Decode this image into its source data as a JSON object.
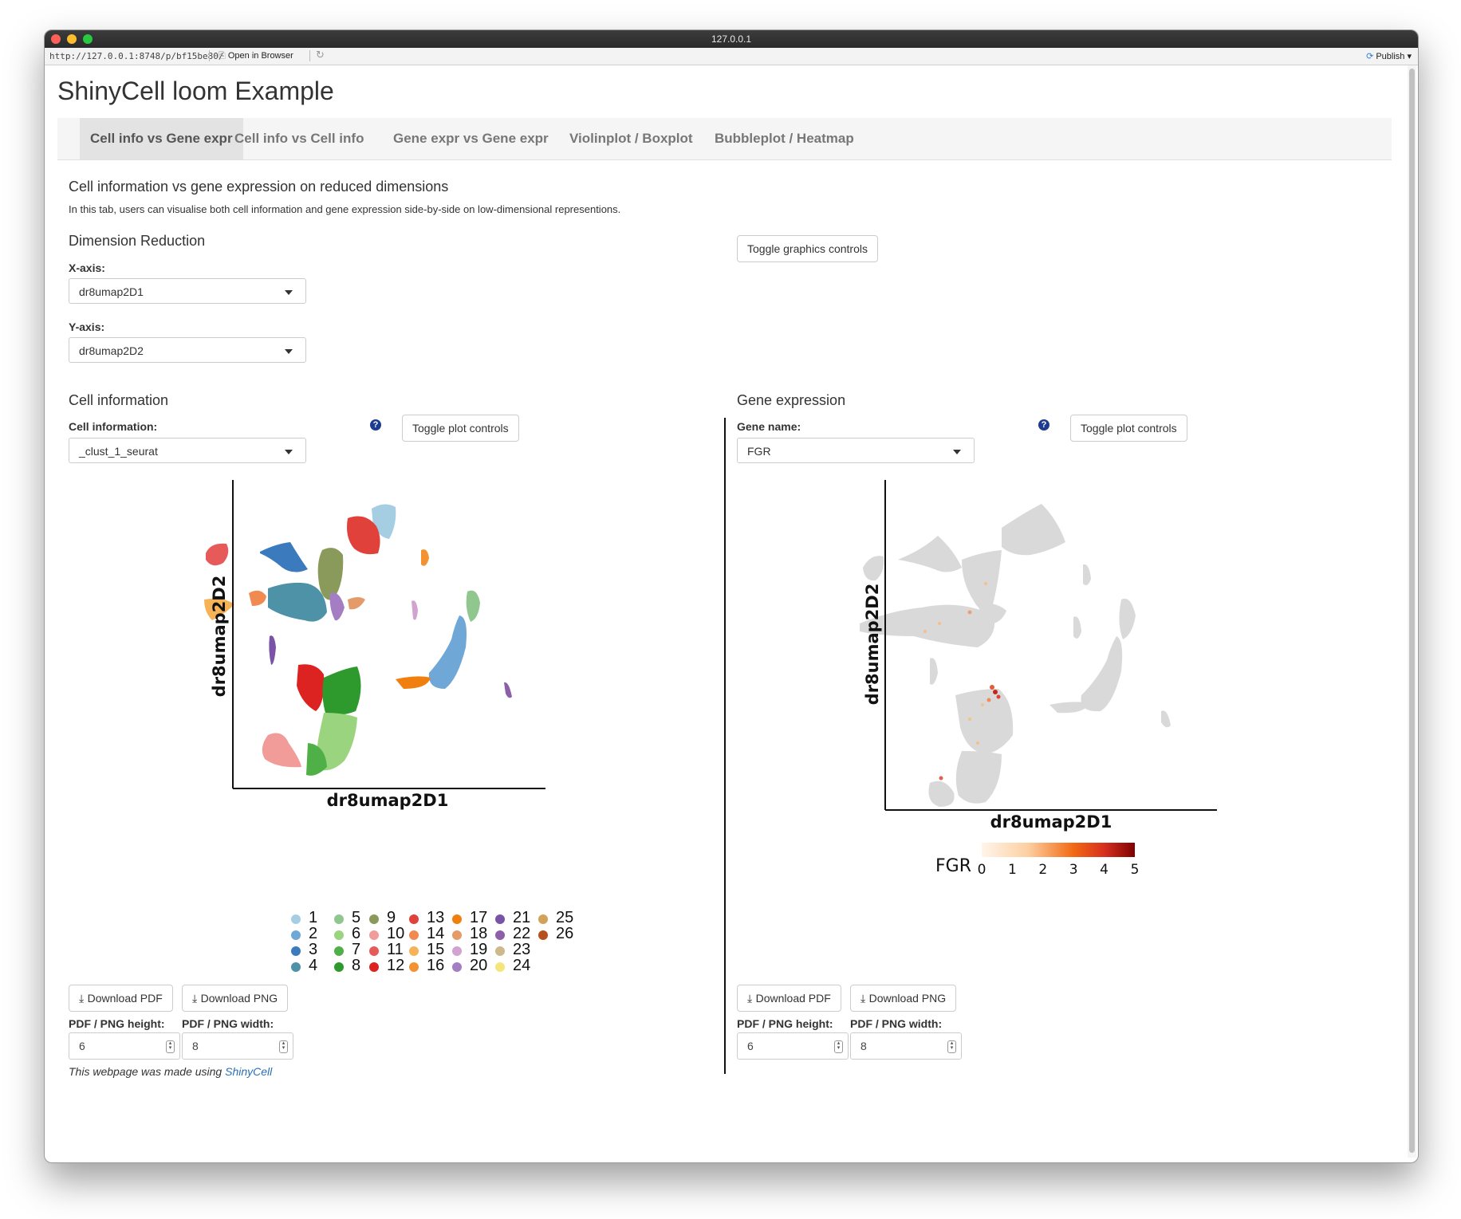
{
  "window": {
    "title": "127.0.0.1"
  },
  "addressbar": {
    "url": "http://127.0.0.1:8748/p/bf15be80/",
    "open_in_browser": "Open in Browser",
    "publish": "Publish"
  },
  "app": {
    "title": "ShinyCell loom Example"
  },
  "tabs": [
    {
      "label": "Cell info vs Gene expr",
      "active": true
    },
    {
      "label": "Cell info vs Cell info",
      "active": false
    },
    {
      "label": "Gene expr vs Gene expr",
      "active": false
    },
    {
      "label": "Violinplot / Boxplot",
      "active": false
    },
    {
      "label": "Bubbleplot / Heatmap",
      "active": false
    }
  ],
  "intro": {
    "title": "Cell information vs gene expression on reduced dimensions",
    "description": "In this tab, users can visualise both cell information and gene expression side-by-side on low-dimensional representions."
  },
  "dimred": {
    "title": "Dimension Reduction",
    "x_label": "X-axis:",
    "x_value": "dr8umap2D1",
    "y_label": "Y-axis:",
    "y_value": "dr8umap2D2",
    "toggle_graphics": "Toggle graphics controls"
  },
  "cellinfo": {
    "title": "Cell information",
    "field_label": "Cell information:",
    "field_value": "_clust_1_seurat",
    "toggle": "Toggle plot controls",
    "help_icon": "?",
    "xlabel": "dr8umap2D1",
    "ylabel": "dr8umap2D2",
    "download_pdf": "Download PDF",
    "download_png": "Download PNG",
    "height_label": "PDF / PNG height:",
    "width_label": "PDF / PNG width:",
    "height_value": "6",
    "width_value": "8"
  },
  "geneexpr": {
    "title": "Gene expression",
    "field_label": "Gene name:",
    "field_value": "FGR",
    "toggle": "Toggle plot controls",
    "help_icon": "?",
    "xlabel": "dr8umap2D1",
    "ylabel": "dr8umap2D2",
    "colorbar_title": "FGR",
    "colorbar_ticks": [
      "0",
      "1",
      "2",
      "3",
      "4",
      "5"
    ],
    "download_pdf": "Download PDF",
    "download_png": "Download PNG",
    "height_label": "PDF / PNG height:",
    "width_label": "PDF / PNG width:",
    "height_value": "6",
    "width_value": "8"
  },
  "legend": [
    {
      "label": "1",
      "color": "#a6cee3"
    },
    {
      "label": "2",
      "color": "#6fa8d6"
    },
    {
      "label": "3",
      "color": "#3b7bbd"
    },
    {
      "label": "4",
      "color": "#4e92a8"
    },
    {
      "label": "5",
      "color": "#8fc78f"
    },
    {
      "label": "6",
      "color": "#9bd47f"
    },
    {
      "label": "7",
      "color": "#4fb047"
    },
    {
      "label": "8",
      "color": "#2e9a2e"
    },
    {
      "label": "9",
      "color": "#8a9a5b"
    },
    {
      "label": "10",
      "color": "#f19c99"
    },
    {
      "label": "11",
      "color": "#e75a5a"
    },
    {
      "label": "12",
      "color": "#dd2222"
    },
    {
      "label": "13",
      "color": "#e0413a"
    },
    {
      "label": "14",
      "color": "#f08a50"
    },
    {
      "label": "15",
      "color": "#f6b257"
    },
    {
      "label": "16",
      "color": "#f39230"
    },
    {
      "label": "17",
      "color": "#f07f0e"
    },
    {
      "label": "18",
      "color": "#e59a6a"
    },
    {
      "label": "19",
      "color": "#d0a3d0"
    },
    {
      "label": "20",
      "color": "#a47dc2"
    },
    {
      "label": "21",
      "color": "#7a52a6"
    },
    {
      "label": "22",
      "color": "#8d5fa8"
    },
    {
      "label": "23",
      "color": "#cdb98a"
    },
    {
      "label": "24",
      "color": "#f5e57a"
    },
    {
      "label": "25",
      "color": "#d2a15a"
    },
    {
      "label": "26",
      "color": "#b5501f"
    }
  ],
  "footer": {
    "text": "This webpage was made using ",
    "link": "ShinyCell"
  }
}
